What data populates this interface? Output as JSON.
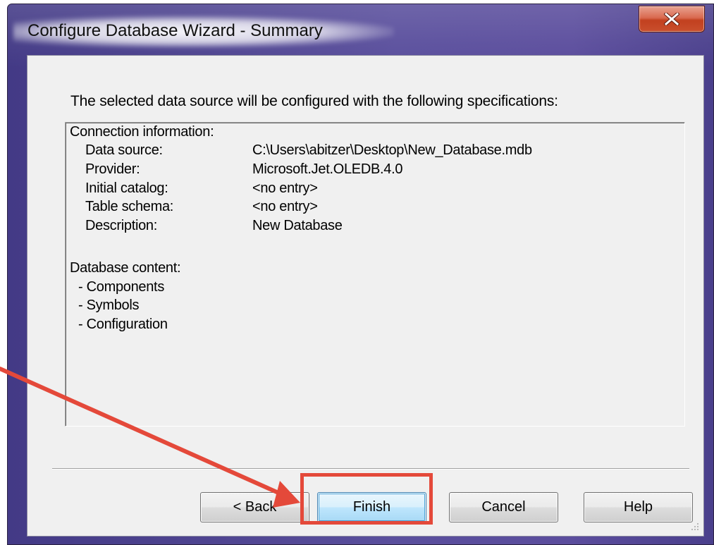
{
  "window": {
    "title": "Configure Database Wizard - Summary",
    "close_icon": "close-icon"
  },
  "content": {
    "intro": "The selected data source will be configured with the following specifications:"
  },
  "summary": {
    "connection_header": "Connection information:",
    "connection_rows": [
      {
        "label": "Data source:",
        "value": "C:\\Users\\abitzer\\Desktop\\New_Database.mdb"
      },
      {
        "label": "Provider:",
        "value": "Microsoft.Jet.OLEDB.4.0"
      },
      {
        "label": "Initial catalog:",
        "value": "<no entry>"
      },
      {
        "label": "Table schema:",
        "value": "<no entry>"
      },
      {
        "label": "Description:",
        "value": "New Database"
      }
    ],
    "content_header": "Database content:",
    "content_items": [
      "- Components",
      "- Symbols",
      "- Configuration"
    ]
  },
  "buttons": {
    "back": "< Back",
    "finish": "Finish",
    "cancel": "Cancel",
    "help": "Help"
  },
  "annotation": {
    "color": "#e4493a",
    "target": "Finish"
  },
  "colors": {
    "frame": "#5a4f9d",
    "close_button": "#c94f2d",
    "dialog_background": "#f0f0f0"
  }
}
